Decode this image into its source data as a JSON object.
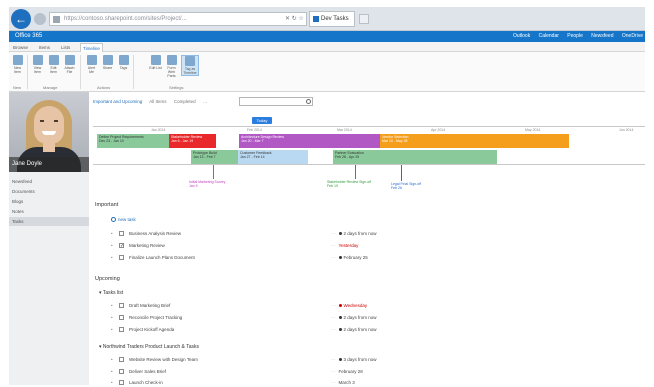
{
  "browser": {
    "address": "https://contoso.sharepoint.com/sites/Project/...",
    "tab_title": "Dev Tasks",
    "tools": "✕ ↻ ☆"
  },
  "suite": {
    "title": "Office 365",
    "links": [
      "Outlook",
      "Calendar",
      "People",
      "Newsfeed",
      "OneDrive"
    ]
  },
  "ribbon_tabs": [
    "Browse",
    "Items",
    "Lists",
    "Timeline"
  ],
  "ribbon": {
    "buttons": [
      "New Item",
      "View Item",
      "Edit Item",
      "Attach File",
      "Alert Me",
      "Share",
      "Tags",
      "Edit List",
      "Form Web Parts",
      "Tag as Timeline"
    ],
    "groups": [
      "New",
      "Manage",
      "Actions",
      "Settings"
    ]
  },
  "profile": {
    "name": "Jane Doyle"
  },
  "left_nav": [
    "Newsfeed",
    "Documents",
    "Blogs",
    "Notes",
    "Tasks"
  ],
  "filters": {
    "items": [
      "Important and Upcoming",
      "All Items",
      "Completed"
    ],
    "more": "…"
  },
  "timeline": {
    "today_label": "Today",
    "ticks": [
      "Jan 2014",
      "Feb 2014",
      "Mar 2014",
      "Apr 2014",
      "May 2014",
      "Jun 2014"
    ],
    "bars": [
      {
        "label": "Define Project Requirements",
        "date": "Dec 23 - Jan 10",
        "color": "#8ac99a"
      },
      {
        "label": "Stakeholder Review",
        "date": "Jan 6 - Jan 19",
        "color": "#e8282b"
      },
      {
        "label": "Architecture Design Review",
        "date": "Jan 20 - Mar 7",
        "color": "#b158c5"
      },
      {
        "label": "Vendor Selection",
        "date": "Mar 10 - May 25",
        "color": "#f59e1c"
      },
      {
        "label": "Prototype Build",
        "date": "Jan 13 - Feb 7",
        "color": "#8ac99a"
      },
      {
        "label": "Customer Feedback",
        "date": "Jan 27 - Feb 14",
        "color": "#b9d9f2"
      },
      {
        "label": "Partner Evaluation",
        "date": "Feb 28 - Apr 25",
        "color": "#8ac99a"
      }
    ],
    "callouts": [
      {
        "label": "Initial Marketing Survey",
        "date": "Jan 9",
        "color": "#c040c0"
      },
      {
        "label": "Stakeholder Review Sign-off",
        "date": "Feb 19",
        "color": "#2e9b3a"
      },
      {
        "label": "Legal Final Sign-off",
        "date": "Feb 26",
        "color": "#2a6dd1"
      }
    ]
  },
  "important": {
    "title": "Important",
    "add_label": "new task",
    "rows": [
      {
        "title": "Business Analysis Review",
        "checked": false,
        "due": "2 days from now",
        "red": false
      },
      {
        "title": "Marketing Review",
        "checked": true,
        "due": "Yesterday",
        "red": true
      },
      {
        "title": "Finalize Launch Plans Document",
        "checked": false,
        "due": "February 25",
        "red": false
      }
    ]
  },
  "upcoming": {
    "title": "Upcoming",
    "groups": [
      {
        "title": "Tasks list",
        "rows": [
          {
            "title": "Draft Marketing Brief",
            "checked": false,
            "due": "Wednesday",
            "red": true
          },
          {
            "title": "Reconcile Project Tracking",
            "checked": false,
            "due": "2 days from now",
            "red": false
          },
          {
            "title": "Project Kickoff Agenda",
            "checked": false,
            "due": "2 days from now",
            "red": false
          }
        ]
      },
      {
        "title": "Northwind Traders Product Launch & Tasks",
        "rows": [
          {
            "title": "Website Review with Design Team",
            "checked": false,
            "due": "3 days from now",
            "red": false
          },
          {
            "title": "Deliver Sales Brief",
            "checked": false,
            "due": "February 28",
            "red": false
          },
          {
            "title": "Launch Check-in",
            "checked": false,
            "due": "March 3",
            "red": false
          }
        ]
      }
    ]
  }
}
